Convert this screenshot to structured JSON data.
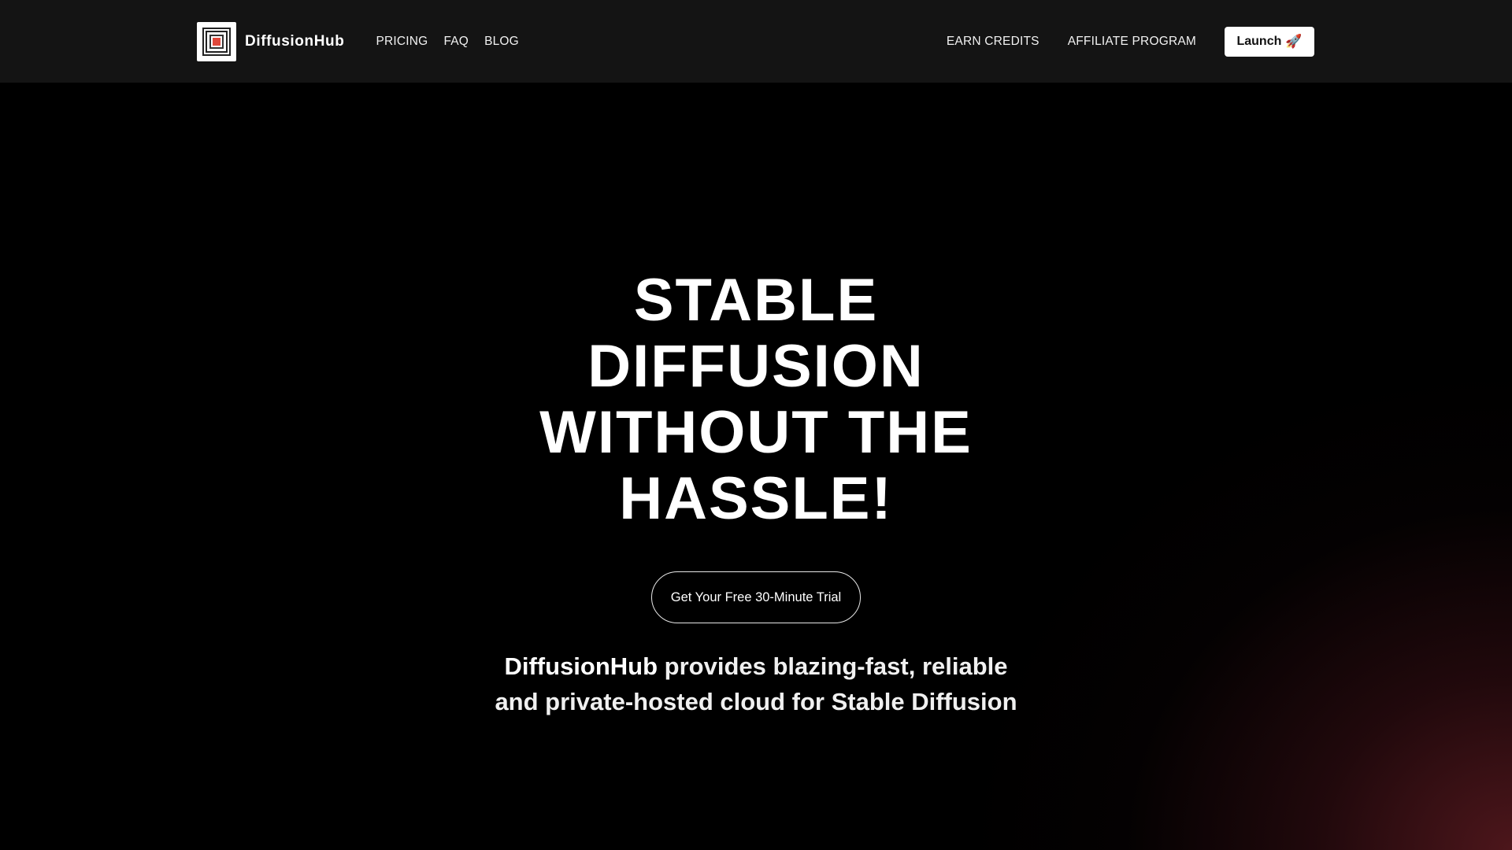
{
  "nav": {
    "brand": "DiffusionHub",
    "left_links": [
      "PRICING",
      "FAQ",
      "BLOG"
    ],
    "right_links": [
      "EARN CREDITS",
      "AFFILIATE PROGRAM"
    ],
    "launch_label": "Launch",
    "launch_icon": "rocket-icon",
    "launch_glyph": "🚀"
  },
  "hero": {
    "title": "STABLE DIFFUSION WITHOUT THE HASSLE!",
    "cta_label": "Get Your Free 30-Minute Trial",
    "tagline_brand": "DiffusionHub",
    "tagline_rest": " provides blazing-fast, reliable and private-hosted cloud for Stable Diffusion"
  },
  "colors": {
    "navbar_bg": "#141414",
    "page_bg": "#000000",
    "glow": "#5a1a20",
    "logo_accent": "#e0473a"
  }
}
